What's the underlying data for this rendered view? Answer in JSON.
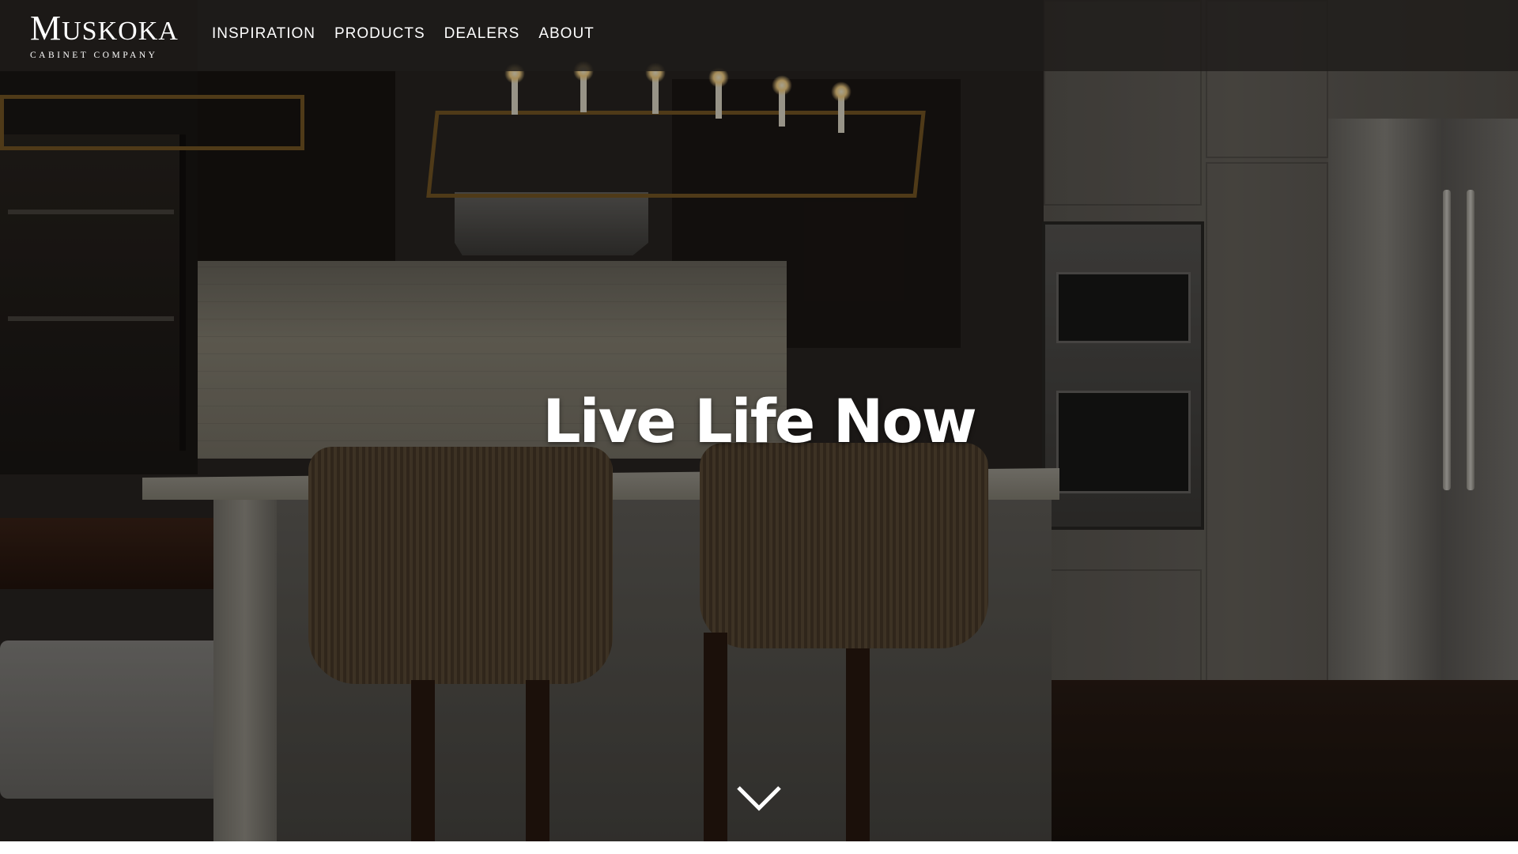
{
  "brand": {
    "name_first": "M",
    "name_rest": "USKOKA",
    "tagline": "CABINET COMPANY"
  },
  "nav": {
    "items": [
      {
        "label": "INSPIRATION"
      },
      {
        "label": "PRODUCTS"
      },
      {
        "label": "DEALERS"
      },
      {
        "label": "ABOUT"
      }
    ]
  },
  "hero": {
    "title": "Live Life Now",
    "scroll_icon": "chevron-down-icon"
  },
  "colors": {
    "nav_bg": "#1e1c1a",
    "text": "#ffffff"
  }
}
